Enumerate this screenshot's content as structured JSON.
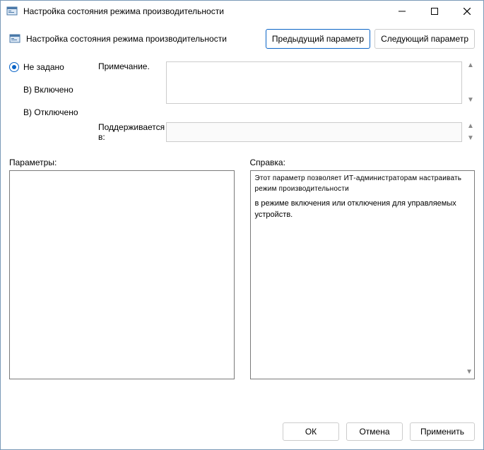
{
  "window": {
    "title": "Настройка состояния режима производительности"
  },
  "header": {
    "title": "Настройка состояния режима производительности",
    "prev_btn": "Предыдущий параметр",
    "next_btn": "Следующий параметр"
  },
  "state": {
    "options": [
      {
        "label": "Не задано",
        "selected": true
      },
      {
        "label": "Включено",
        "selected": false
      },
      {
        "label": "Отключено",
        "selected": false
      }
    ],
    "prefix_v": "В)"
  },
  "labels": {
    "comment": "Примечание.",
    "supported": "Поддерживается в:",
    "options": "Параметры:",
    "help": "Справка:"
  },
  "fields": {
    "comment_value": "",
    "supported_value": ""
  },
  "help": {
    "p1": "Этот параметр позволяет ИТ-администраторам настраивать режим производительности",
    "p2": "в режиме включения или отключения для управляемых устройств."
  },
  "footer": {
    "ok": "ОК",
    "cancel": "Отмена",
    "apply": "Применить"
  }
}
